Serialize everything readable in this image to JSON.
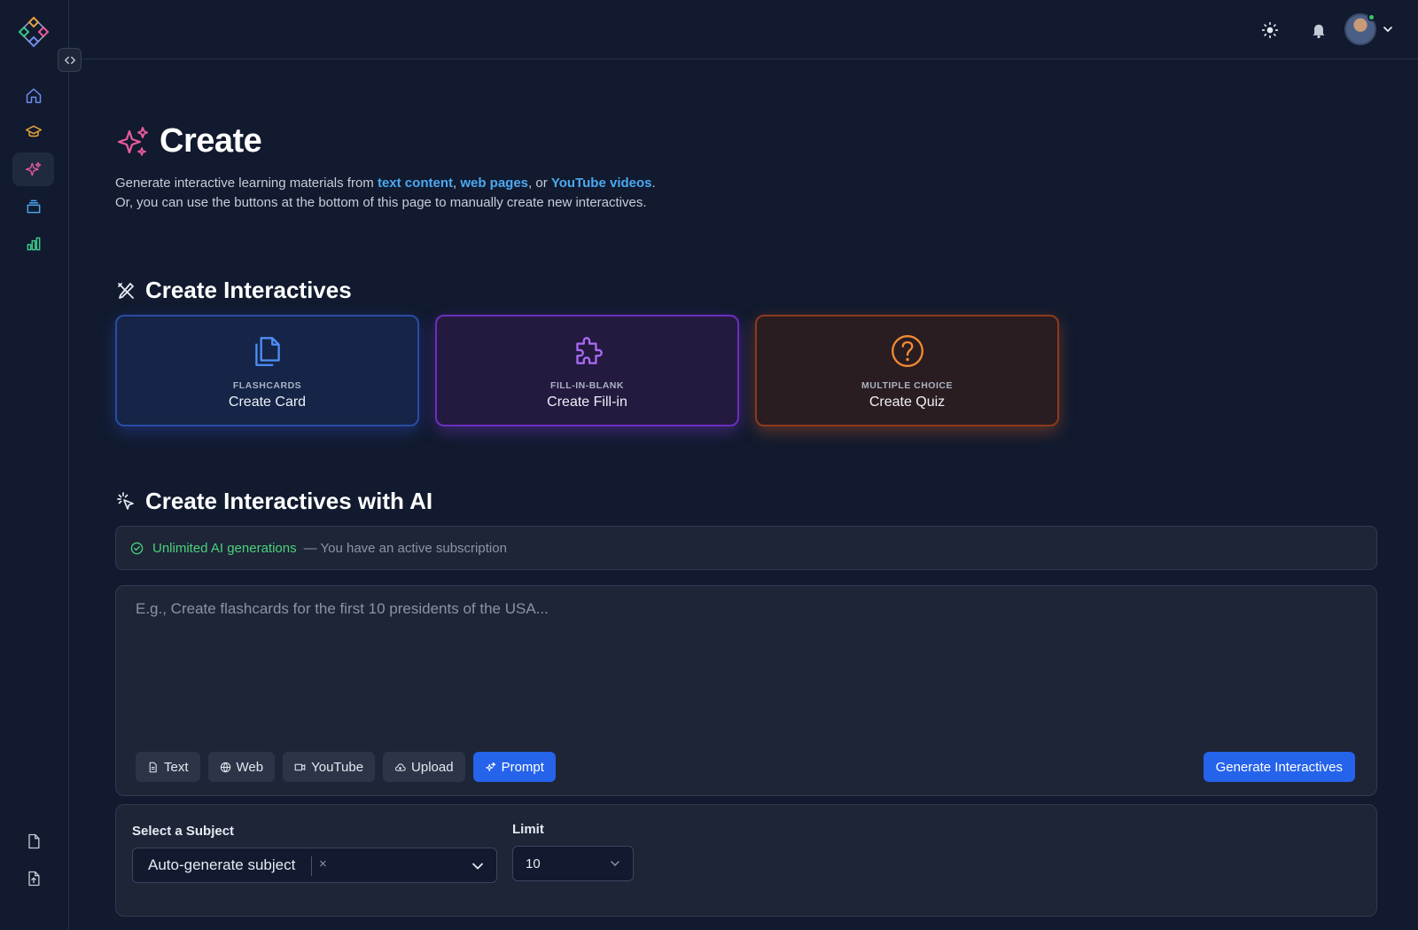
{
  "header": {
    "theme_icon": "sun-icon",
    "notifications_icon": "bell-icon",
    "avatar_icon": "user-avatar",
    "menu_icon": "chevron-down-icon"
  },
  "sidebar": {
    "logo_icon": "app-logo",
    "collapse_icon": "code-brackets-icon",
    "items": [
      {
        "name": "home",
        "icon": "home-icon",
        "color": "#6e8cf0",
        "active": false
      },
      {
        "name": "learn",
        "icon": "graduation-cap-icon",
        "color": "#e8a23b",
        "active": false
      },
      {
        "name": "create",
        "icon": "sparkles-icon",
        "color": "#e85b9c",
        "active": true
      },
      {
        "name": "library",
        "icon": "layers-icon",
        "color": "#4aa3f0",
        "active": false
      },
      {
        "name": "stats",
        "icon": "bar-chart-icon",
        "color": "#3cc68a",
        "active": false
      }
    ],
    "bottom_items": [
      {
        "name": "docs",
        "icon": "file-icon"
      },
      {
        "name": "export",
        "icon": "file-upload-icon"
      }
    ]
  },
  "page": {
    "title": "Create",
    "intro": {
      "part1": "Generate interactive learning materials from ",
      "link1": "text content",
      "part2": ", ",
      "link2": "web pages",
      "part3": ", or ",
      "link3": "YouTube videos",
      "part4": ". Or, you can use the buttons at the bottom of this page to manually create new interactives."
    }
  },
  "create_section": {
    "title": "Create Interactives",
    "cards": [
      {
        "kicker": "FLASHCARDS",
        "label": "Create Card",
        "icon": "copy-icon",
        "color": "#4f8ff7"
      },
      {
        "kicker": "FILL-IN-BLANK",
        "label": "Create Fill-in",
        "icon": "puzzle-icon",
        "color": "#a86cf5"
      },
      {
        "kicker": "MULTIPLE CHOICE",
        "label": "Create Quiz",
        "icon": "question-circle-icon",
        "color": "#f28b35"
      }
    ]
  },
  "ai_section": {
    "title": "Create Interactives with AI",
    "status_ok": "Unlimited AI generations",
    "status_muted": "— You have an active subscription",
    "prompt_placeholder": "E.g., Create flashcards for the first 10 presidents of the USA...",
    "prompt_value": "",
    "modes": [
      {
        "label": "Text",
        "icon": "file-text-icon",
        "active": false
      },
      {
        "label": "Web",
        "icon": "globe-icon",
        "active": false
      },
      {
        "label": "YouTube",
        "icon": "video-icon",
        "active": false
      },
      {
        "label": "Upload",
        "icon": "cloud-upload-icon",
        "active": false
      },
      {
        "label": "Prompt",
        "icon": "sparkles-icon",
        "active": true
      }
    ],
    "generate_label": "Generate Interactives"
  },
  "options": {
    "subject_label": "Select a Subject",
    "subject_value": "Auto-generate subject",
    "subject_clear": "×",
    "limit_label": "Limit",
    "limit_value": "10"
  }
}
